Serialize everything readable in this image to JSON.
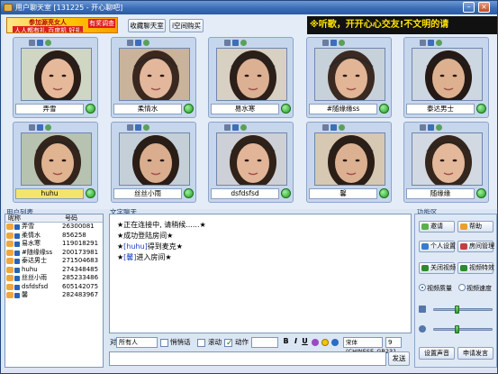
{
  "window": {
    "title": "用户聊天室 [131225 - 开心聊吧]"
  },
  "ad": {
    "line1": "参加源亮女人",
    "line2": "人人都有礼 百度机 好礼",
    "badge": "有奖调查"
  },
  "top_buttons": {
    "favorite": "收藏聊天室",
    "space": "i空间购买"
  },
  "marquee": {
    "text": "※听歌，开开心心交友!不文明的请"
  },
  "video_cells": [
    {
      "name": "弄雪",
      "selected": false
    },
    {
      "name": "柔情水",
      "selected": false
    },
    {
      "name": "易水寒",
      "selected": false
    },
    {
      "name": "#随缘缘ss",
      "selected": false
    },
    {
      "name": "泰达男士",
      "selected": false
    },
    {
      "name": "",
      "selected": false
    },
    {
      "name": "huhu",
      "selected": true
    },
    {
      "name": "丝丝小雨",
      "selected": false
    },
    {
      "name": "dsfdsfsd",
      "selected": false
    },
    {
      "name": "馨",
      "selected": false
    },
    {
      "name": "随缘缘",
      "selected": false
    }
  ],
  "userlist": {
    "label": "用户列表",
    "col_name": "昵称",
    "col_num": "号码",
    "users": [
      {
        "name": "弄雪",
        "num": "26300081"
      },
      {
        "name": "柔情水",
        "num": "856258"
      },
      {
        "name": "易水寒",
        "num": "119018291"
      },
      {
        "name": "#随缘缘ss",
        "num": "200173981"
      },
      {
        "name": "泰达男士",
        "num": "271504683"
      },
      {
        "name": "huhu",
        "num": "274348485"
      },
      {
        "name": "丝丝小雨",
        "num": "285233486"
      },
      {
        "name": "dsfdsfsd",
        "num": "605142075"
      },
      {
        "name": "馨",
        "num": "282483967"
      }
    ]
  },
  "chat": {
    "label": "文字聊天",
    "lines": [
      {
        "pre": "★正在连接中, 请稍候......★",
        "user": "",
        "post": ""
      },
      {
        "pre": "★成功登陆房间★",
        "user": "",
        "post": ""
      },
      {
        "pre": "★",
        "user": "[huhu]",
        "post": "得到麦克★"
      },
      {
        "pre": "★",
        "user": "[馨]",
        "post": "进入房间★"
      }
    ]
  },
  "toolbar": {
    "to_label": "对",
    "to_value": "所有人",
    "private_label": "悄悄话",
    "scroll_label": "滚动",
    "action_label": "动作",
    "font": "宋体 (CHINESE_GB231",
    "size": "9"
  },
  "send_button": "发送",
  "functions": {
    "label": "功能区",
    "b1": "邀请",
    "b2": "帮助",
    "b3": "个人设置",
    "b4": "房间管理",
    "b5": "关闭视频",
    "b6": "视频特效",
    "r1": "视频质量",
    "r2": "视频速度",
    "sound": "设置声音",
    "publish": "申请发言"
  },
  "colors": {
    "title_bar": "#3a6cb6",
    "marquee_text": "#ffe400",
    "chat_user": "#1a3fbf"
  }
}
